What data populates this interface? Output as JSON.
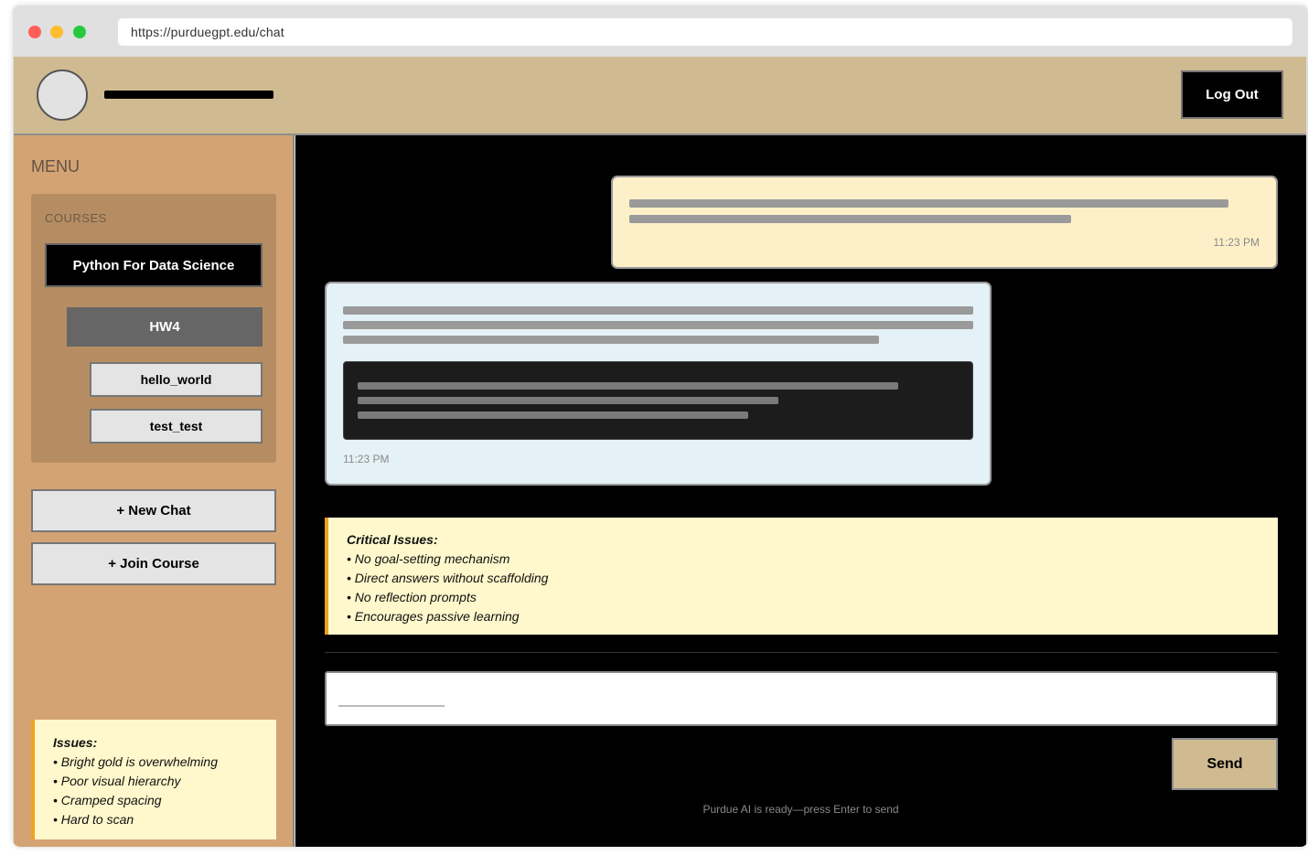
{
  "browser": {
    "url": "https://purduegpt.edu/chat",
    "traffic_light_colors": [
      "#ff5f57",
      "#febc2e",
      "#28c840"
    ]
  },
  "header": {
    "logout_label": "Log Out",
    "background": "#cfba92"
  },
  "sidebar": {
    "menu_title": "MENU",
    "courses_label": "COURSES",
    "course": "Python For Data Science",
    "assignment": "HW4",
    "files": [
      "hello_world",
      "test_test"
    ],
    "new_chat_label": "+ New Chat",
    "join_course_label": "+ Join Course",
    "background": "#d4a373",
    "note": {
      "title": "Issues:",
      "items": [
        "• Bright gold is overwhelming",
        "• Poor visual hierarchy",
        "• Cramped spacing",
        "• Hard to scan"
      ]
    }
  },
  "chat": {
    "user_message_time": "11:23 PM",
    "ai_message_time": "11:23 PM",
    "send_label": "Send",
    "input_value": "",
    "status_text": "Purdue AI is ready—press Enter to send",
    "note": {
      "title": "Critical Issues:",
      "items": [
        "• No goal-setting mechanism",
        "• Direct answers without scaffolding",
        "• No reflection prompts",
        "• Encourages passive learning"
      ]
    }
  },
  "colors": {
    "accent_gold": "#cfba92",
    "note_background": "#fff8cc",
    "note_border": "#f0a020",
    "user_bubble": "#fdf0c8",
    "ai_bubble": "#e4f1f6"
  }
}
